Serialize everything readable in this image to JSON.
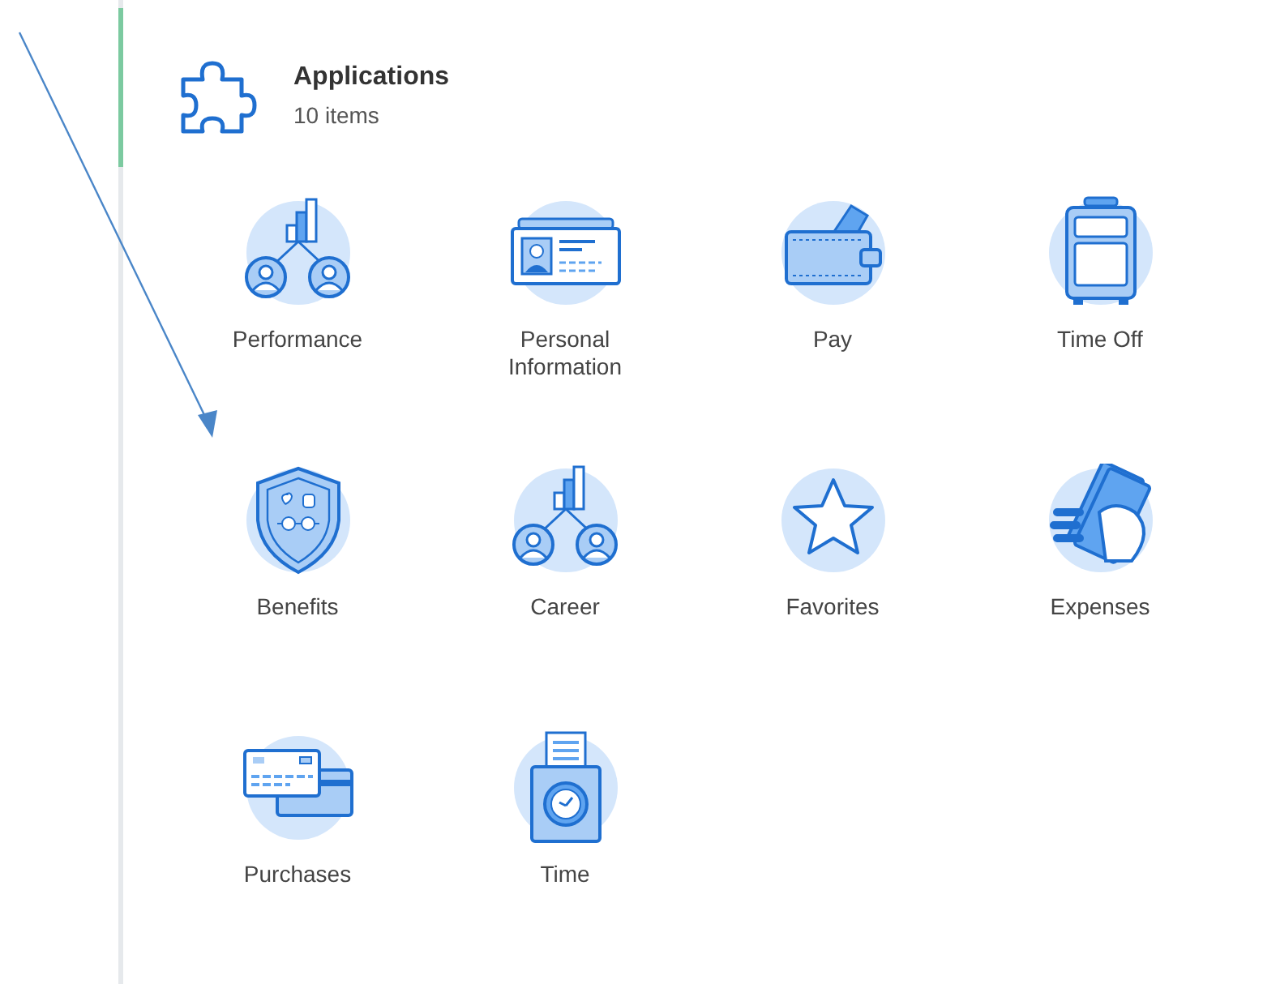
{
  "header": {
    "title": "Applications",
    "count": "10 items"
  },
  "apps": [
    {
      "label": "Performance",
      "kind": "performance"
    },
    {
      "label": "Personal Information",
      "kind": "personal"
    },
    {
      "label": "Pay",
      "kind": "pay"
    },
    {
      "label": "Time Off",
      "kind": "timeoff"
    },
    {
      "label": "Benefits",
      "kind": "benefits"
    },
    {
      "label": "Career",
      "kind": "career"
    },
    {
      "label": "Favorites",
      "kind": "favorites"
    },
    {
      "label": "Expenses",
      "kind": "expenses"
    },
    {
      "label": "Purchases",
      "kind": "purchases"
    },
    {
      "label": "Time",
      "kind": "time"
    }
  ]
}
